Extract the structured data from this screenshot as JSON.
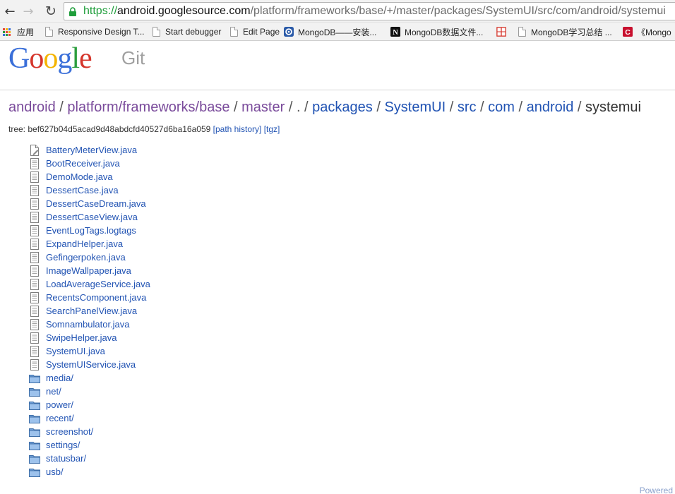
{
  "browser": {
    "url_scheme": "https://",
    "url_host": "android.googlesource.com",
    "url_path": "/platform/frameworks/base/+/master/packages/SystemUI/src/com/android/systemui",
    "bookmarks": [
      {
        "label": "应用",
        "icon": "apps-icon"
      },
      {
        "label": "Responsive Design T...",
        "icon": "page-icon"
      },
      {
        "label": "Start debugger",
        "icon": "page-icon"
      },
      {
        "label": "Edit Page",
        "icon": "page-icon"
      },
      {
        "label": "MongoDB——安装...",
        "icon": "swirl-icon"
      },
      {
        "label": "MongoDB数据文件...",
        "icon": "notion-n-icon"
      },
      {
        "label": "",
        "icon": "red-grid-icon"
      },
      {
        "label": "MongoDB学习总结 ...",
        "icon": "page-icon"
      },
      {
        "label": "《Mongo",
        "icon": "red-c-icon"
      }
    ]
  },
  "header": {
    "logo_letters": [
      "G",
      "o",
      "o",
      "g",
      "l",
      "e"
    ],
    "logo_colors": [
      "#3a6fd9",
      "#d5352b",
      "#f4b400",
      "#3a6fd9",
      "#2c9e3e",
      "#d5352b"
    ],
    "product": "Git"
  },
  "breadcrumb": {
    "items": [
      {
        "label": "android",
        "visited": true
      },
      {
        "label": "platform/frameworks/base",
        "visited": true
      },
      {
        "label": "master",
        "visited": true
      },
      {
        "label": ".",
        "visited": false,
        "plain": true
      },
      {
        "label": "packages",
        "visited": false
      },
      {
        "label": "SystemUI",
        "visited": false
      },
      {
        "label": "src",
        "visited": false
      },
      {
        "label": "com",
        "visited": false
      },
      {
        "label": "android",
        "visited": false
      }
    ],
    "current": "systemui",
    "separator": " / "
  },
  "tree": {
    "prefix": "tree: ",
    "hash": "bef627b04d5acad9d48abdcfd40527d6ba16a059",
    "path_history": "[path history]",
    "tgz": "[tgz]"
  },
  "entries": [
    {
      "name": "BatteryMeterView.java",
      "type": "file-edit"
    },
    {
      "name": "BootReceiver.java",
      "type": "file"
    },
    {
      "name": "DemoMode.java",
      "type": "file"
    },
    {
      "name": "DessertCase.java",
      "type": "file"
    },
    {
      "name": "DessertCaseDream.java",
      "type": "file"
    },
    {
      "name": "DessertCaseView.java",
      "type": "file"
    },
    {
      "name": "EventLogTags.logtags",
      "type": "file"
    },
    {
      "name": "ExpandHelper.java",
      "type": "file"
    },
    {
      "name": "Gefingerpoken.java",
      "type": "file"
    },
    {
      "name": "ImageWallpaper.java",
      "type": "file"
    },
    {
      "name": "LoadAverageService.java",
      "type": "file"
    },
    {
      "name": "RecentsComponent.java",
      "type": "file"
    },
    {
      "name": "SearchPanelView.java",
      "type": "file"
    },
    {
      "name": "Somnambulator.java",
      "type": "file"
    },
    {
      "name": "SwipeHelper.java",
      "type": "file"
    },
    {
      "name": "SystemUI.java",
      "type": "file"
    },
    {
      "name": "SystemUIService.java",
      "type": "file"
    },
    {
      "name": "media/",
      "type": "folder"
    },
    {
      "name": "net/",
      "type": "folder"
    },
    {
      "name": "power/",
      "type": "folder"
    },
    {
      "name": "recent/",
      "type": "folder"
    },
    {
      "name": "screenshot/",
      "type": "folder"
    },
    {
      "name": "settings/",
      "type": "folder"
    },
    {
      "name": "statusbar/",
      "type": "folder"
    },
    {
      "name": "usb/",
      "type": "folder"
    }
  ],
  "footer": {
    "powered": "Powered"
  }
}
